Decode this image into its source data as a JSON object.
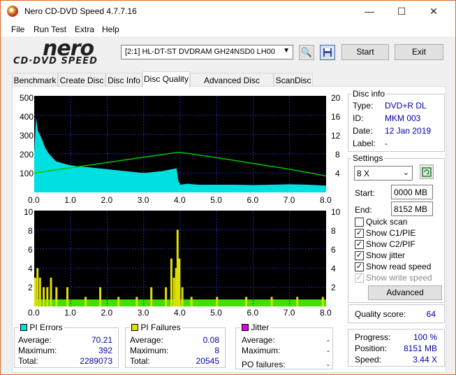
{
  "window": {
    "title": "Nero CD-DVD Speed 4.7.7.16",
    "minimize": "—",
    "maximize": "☐",
    "close": "✕"
  },
  "menu": [
    "File",
    "Run Test",
    "Extra",
    "Help"
  ],
  "logo": {
    "line1": "nero",
    "line2": "CD·DVD SPEED"
  },
  "toolbar": {
    "drive": "[2:1]  HL-DT-ST DVDRAM GH24NSD0 LH00",
    "start": "Start",
    "exit": "Exit"
  },
  "tabs": [
    "Benchmark",
    "Create Disc",
    "Disc Info",
    "Disc Quality",
    "Advanced Disc Quality",
    "ScanDisc"
  ],
  "active_tab": "Disc Quality",
  "disc_info": {
    "title": "Disc info",
    "type_label": "Type:",
    "type": "DVD+R DL",
    "id_label": "ID:",
    "id": "MKM 003",
    "date_label": "Date:",
    "date": "12 Jan 2019",
    "label_label": "Label:",
    "label": "-"
  },
  "settings": {
    "title": "Settings",
    "speed": "8 X",
    "start_label": "Start:",
    "start": "0000 MB",
    "end_label": "End:",
    "end": "8152 MB",
    "quick_scan": "Quick scan",
    "show_c1": "Show C1/PIE",
    "show_c2": "Show C2/PIF",
    "show_jitter": "Show jitter",
    "show_read": "Show read speed",
    "show_write": "Show write speed",
    "advanced": "Advanced"
  },
  "quality": {
    "label": "Quality score:",
    "value": "64"
  },
  "progress": {
    "progress_label": "Progress:",
    "progress": "100 %",
    "position_label": "Position:",
    "position": "8151 MB",
    "speed_label": "Speed:",
    "speed": "3.44 X"
  },
  "pi_errors": {
    "title": "PI Errors",
    "avg_label": "Average:",
    "avg": "70.21",
    "max_label": "Maximum:",
    "max": "392",
    "total_label": "Total:",
    "total": "2289073",
    "color": "#00e0e0"
  },
  "pi_failures": {
    "title": "PI Failures",
    "avg_label": "Average:",
    "avg": "0.08",
    "max_label": "Maximum:",
    "max": "8",
    "total_label": "Total:",
    "total": "20545",
    "color": "#e0e000"
  },
  "jitter": {
    "title": "Jitter",
    "avg_label": "Average:",
    "avg": "-",
    "max_label": "Maximum:",
    "max": "-",
    "po_label": "PO failures:",
    "po": "-",
    "color": "#e000e0"
  },
  "chart_data": [
    {
      "type": "area",
      "x_ticks": [
        "0.0",
        "1.0",
        "2.0",
        "3.0",
        "4.0",
        "5.0",
        "6.0",
        "7.0",
        "8.0"
      ],
      "y_left_ticks": [
        "500",
        "400",
        "300",
        "200",
        "100"
      ],
      "y_right_ticks": [
        "20",
        "16",
        "12",
        "8",
        "4"
      ],
      "xlim": [
        0,
        8
      ],
      "ylim": [
        0,
        500
      ],
      "y2lim": [
        0,
        20
      ],
      "series": [
        {
          "name": "PI Errors",
          "color": "#00e0e0",
          "x": [
            0,
            0.05,
            0.1,
            0.2,
            0.3,
            0.4,
            0.5,
            0.6,
            0.8,
            1.0,
            1.2,
            1.5,
            2.0,
            2.5,
            3.0,
            3.5,
            3.9,
            3.95,
            4.0,
            4.2,
            4.5,
            5.0,
            5.5,
            6.0,
            6.5,
            7.0,
            7.5,
            8.0
          ],
          "values": [
            200,
            390,
            320,
            280,
            230,
            200,
            180,
            160,
            150,
            140,
            135,
            130,
            120,
            110,
            100,
            110,
            125,
            60,
            40,
            45,
            40,
            40,
            40,
            38,
            40,
            42,
            40,
            35
          ]
        },
        {
          "name": "Read speed",
          "color": "#00c000",
          "x": [
            0,
            1,
            2,
            3,
            3.95,
            4,
            5,
            6,
            7,
            8
          ],
          "values": [
            4,
            5.1,
            6.2,
            7.3,
            8.3,
            8.3,
            7.2,
            6.0,
            4.8,
            3.4
          ]
        }
      ]
    },
    {
      "type": "bar",
      "x_ticks": [
        "0.0",
        "1.0",
        "2.0",
        "3.0",
        "4.0",
        "5.0",
        "6.0",
        "7.0",
        "8.0"
      ],
      "y_left_ticks": [
        "10",
        "8",
        "6",
        "4",
        "2"
      ],
      "y_right_ticks": [
        "10",
        "8",
        "6",
        "4",
        "2"
      ],
      "xlim": [
        0,
        8
      ],
      "ylim": [
        0,
        10
      ],
      "series": [
        {
          "name": "PI Failures",
          "color": "#e0e000",
          "x": [
            0.02,
            0.08,
            0.15,
            0.25,
            0.35,
            0.45,
            0.6,
            0.9,
            1.4,
            1.8,
            2.3,
            2.8,
            3.2,
            3.6,
            3.75,
            3.82,
            3.88,
            3.92,
            3.97,
            4.05,
            4.3,
            5.0,
            5.8,
            6.5,
            7.2,
            7.9
          ],
          "values": [
            3,
            4,
            3,
            2,
            2,
            3,
            2,
            2,
            1,
            2,
            1,
            1,
            2,
            2,
            5,
            3,
            4,
            8,
            5,
            2,
            1,
            1,
            1,
            1,
            1,
            1
          ]
        }
      ]
    }
  ]
}
